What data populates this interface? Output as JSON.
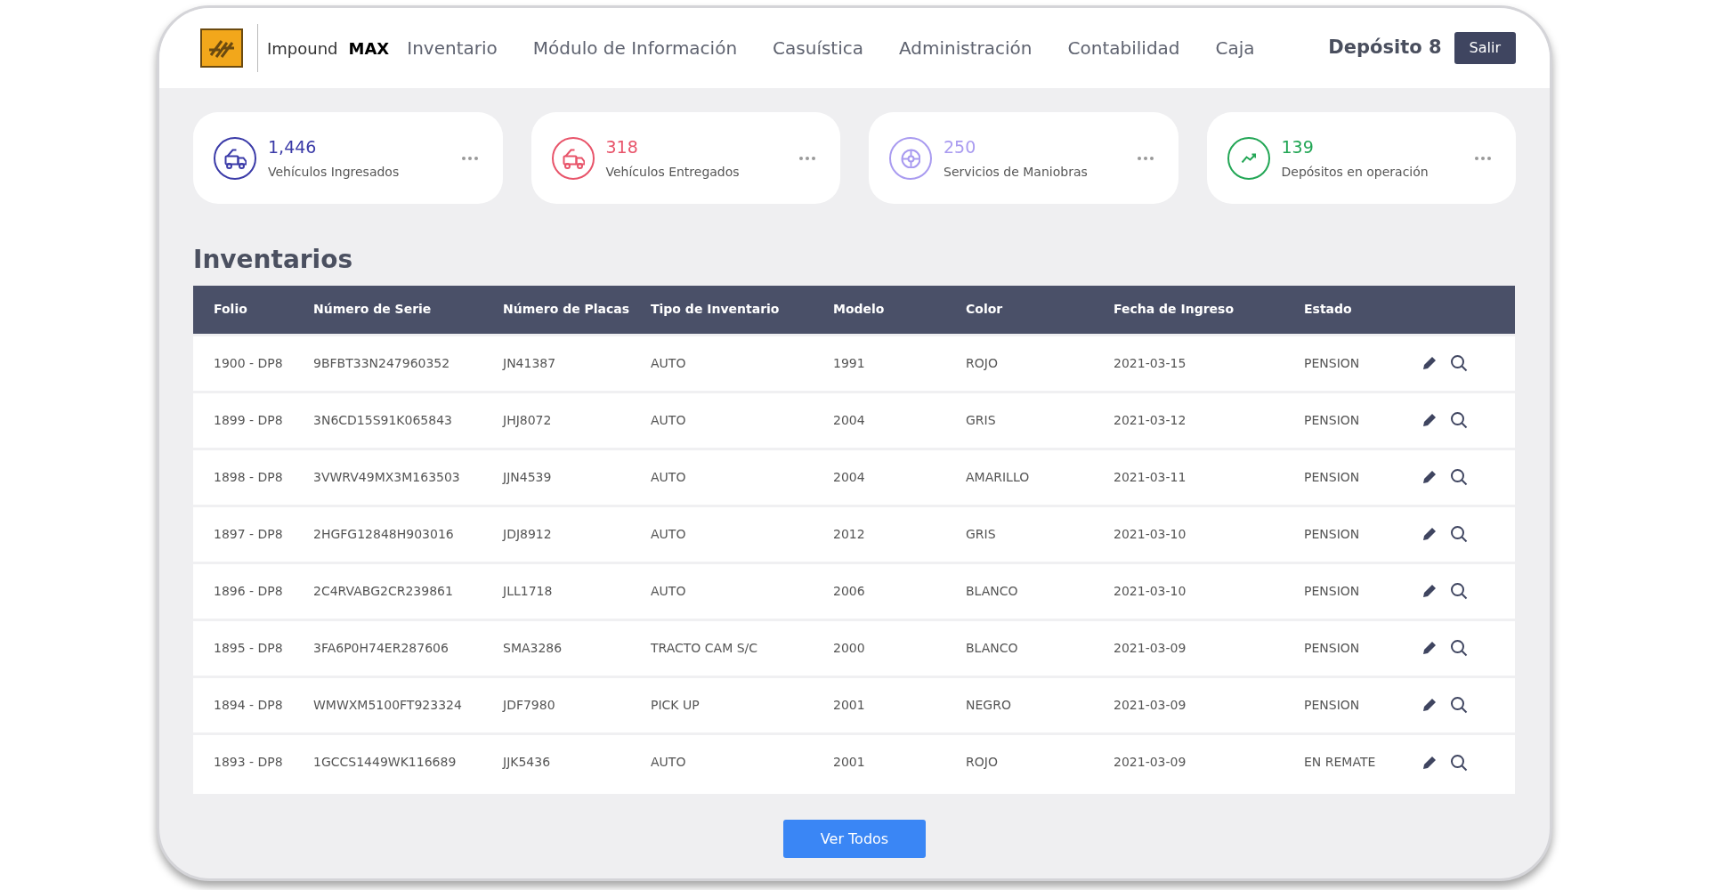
{
  "brand": {
    "name": "Impound",
    "suffix": "MAX"
  },
  "nav": [
    "Inventario",
    "Módulo de Información",
    "Casuística",
    "Administración",
    "Contabilidad",
    "Caja"
  ],
  "depot": "Depósito 8",
  "logout": "Salir",
  "stats": [
    {
      "kind": "truck",
      "value": "1,446",
      "label": "Vehículos Ingresados",
      "color": "#3b3ba8"
    },
    {
      "kind": "truck",
      "value": "318",
      "label": "Vehículos Entregados",
      "color": "#e8546a"
    },
    {
      "kind": "wheel",
      "value": "250",
      "label": "Servicios de Maniobras",
      "color": "#a99bf0"
    },
    {
      "kind": "trend",
      "value": "139",
      "label": "Depósitos en operación",
      "color": "#22a655"
    }
  ],
  "section_title": "Inventarios",
  "table": {
    "columns": [
      "Folio",
      "Número de Serie",
      "Número de Placas",
      "Tipo de Inventario",
      "Modelo",
      "Color",
      "Fecha de Ingreso",
      "Estado"
    ],
    "rows": [
      [
        "1900 - DP8",
        "9BFBT33N247960352",
        "JN41387",
        "AUTO",
        "1991",
        "ROJO",
        "2021-03-15",
        "PENSION"
      ],
      [
        "1899 - DP8",
        "3N6CD15S91K065843",
        "JHJ8072",
        "AUTO",
        "2004",
        "GRIS",
        "2021-03-12",
        "PENSION"
      ],
      [
        "1898 - DP8",
        "3VWRV49MX3M163503",
        "JJN4539",
        "AUTO",
        "2004",
        "AMARILLO",
        "2021-03-11",
        "PENSION"
      ],
      [
        "1897 - DP8",
        "2HGFG12848H903016",
        "JDJ8912",
        "AUTO",
        "2012",
        "GRIS",
        "2021-03-10",
        "PENSION"
      ],
      [
        "1896 - DP8",
        "2C4RVABG2CR239861",
        "JLL1718",
        "AUTO",
        "2006",
        "BLANCO",
        "2021-03-10",
        "PENSION"
      ],
      [
        "1895 - DP8",
        "3FA6P0H74ER287606",
        "SMA3286",
        "TRACTO CAM S/C",
        "2000",
        "BLANCO",
        "2021-03-09",
        "PENSION"
      ],
      [
        "1894 - DP8",
        "WMWXM5100FT923324",
        "JDF7980",
        "PICK UP",
        "2001",
        "NEGRO",
        "2021-03-09",
        "PENSION"
      ],
      [
        "1893 - DP8",
        "1GCCS1449WK116689",
        "JJK5436",
        "AUTO",
        "2001",
        "ROJO",
        "2021-03-09",
        "EN REMATE"
      ]
    ]
  },
  "view_all": "Ver Todos"
}
